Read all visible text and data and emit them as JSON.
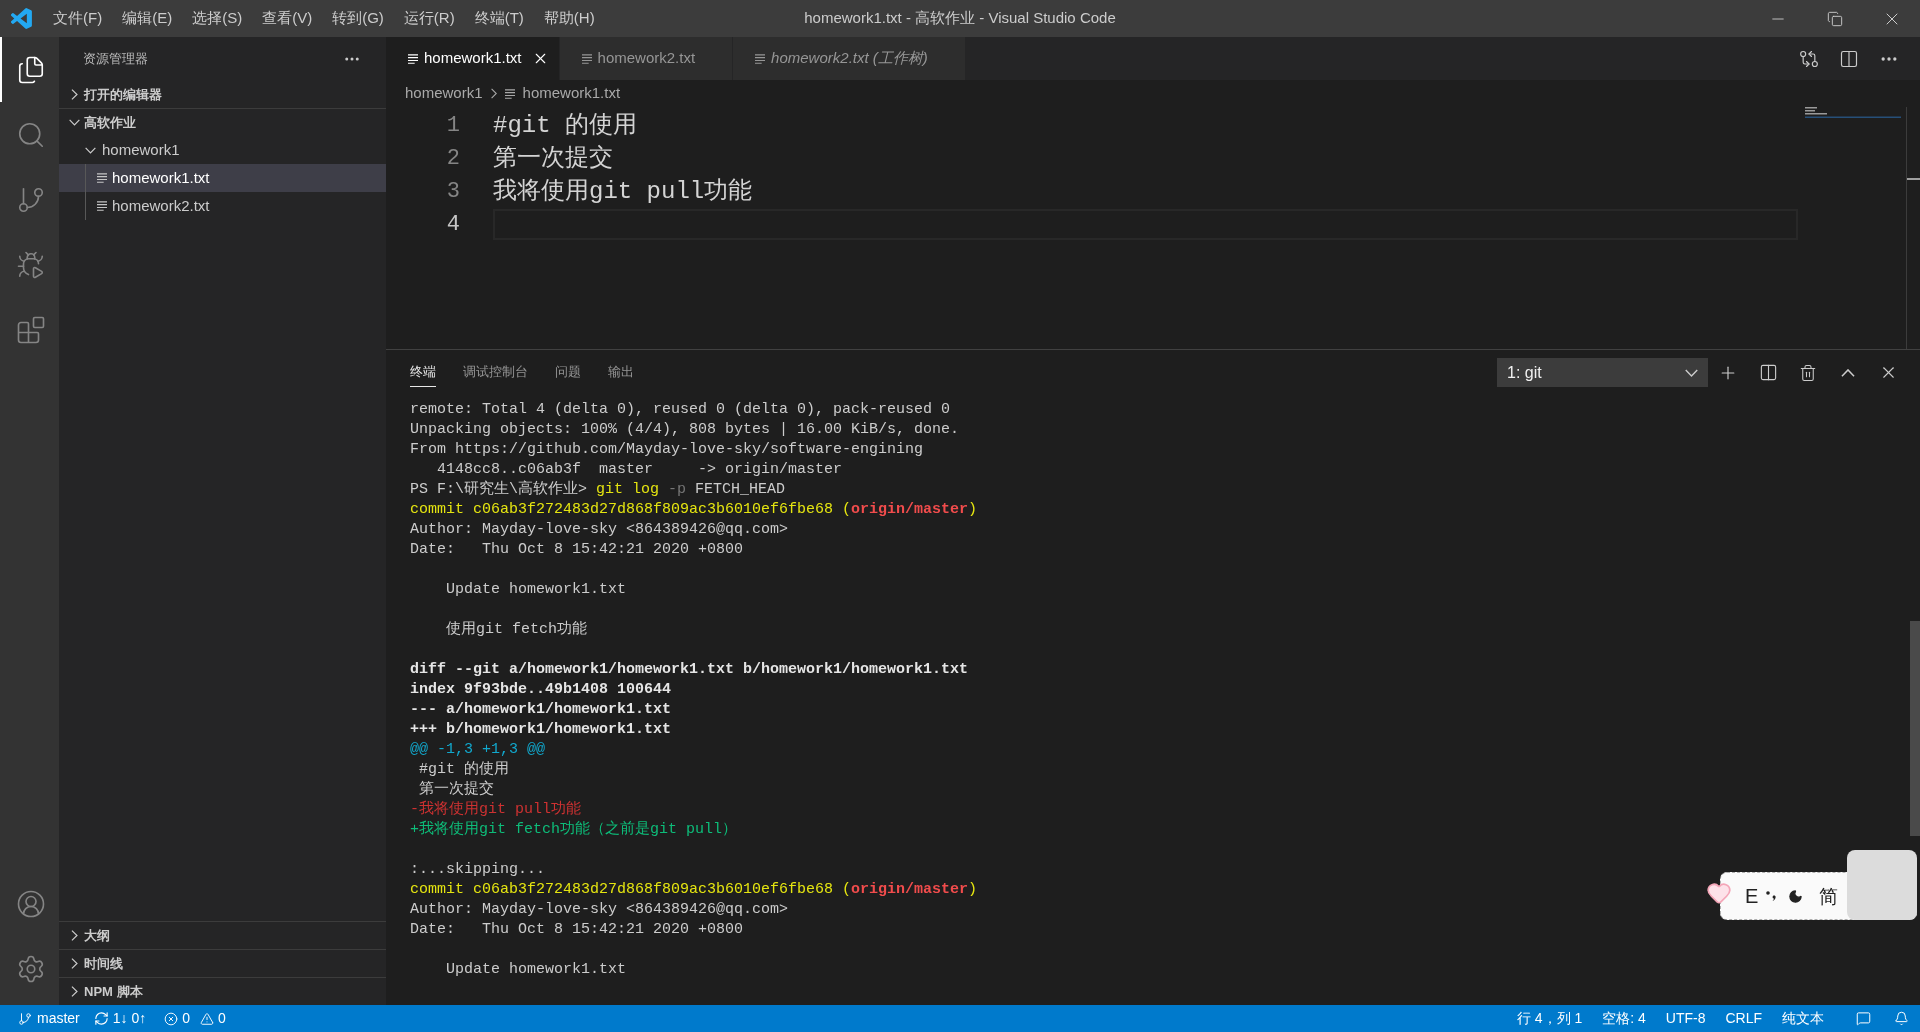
{
  "title_bar": {
    "menu": [
      "文件(F)",
      "编辑(E)",
      "选择(S)",
      "查看(V)",
      "转到(G)",
      "运行(R)",
      "终端(T)",
      "帮助(H)"
    ],
    "title": "homework1.txt - 高软作业 - Visual Studio Code"
  },
  "activity_bar": {
    "items": [
      {
        "kind": "explorer",
        "selected": true
      },
      {
        "kind": "search",
        "selected": false
      },
      {
        "kind": "source-control",
        "selected": false
      },
      {
        "kind": "run",
        "selected": false
      },
      {
        "kind": "extensions",
        "selected": false
      }
    ],
    "bottom": [
      {
        "kind": "account"
      },
      {
        "kind": "settings"
      }
    ]
  },
  "sidebar": {
    "title": "资源管理器",
    "sections": [
      {
        "label": "打开的编辑器",
        "expanded": false
      },
      {
        "label": "高软作业",
        "expanded": true,
        "tree": [
          {
            "kind": "folder",
            "label": "homework1",
            "expanded": true,
            "selected": false,
            "children": [
              {
                "kind": "file",
                "label": "homework1.txt",
                "selected": true
              },
              {
                "kind": "file",
                "label": "homework2.txt",
                "selected": false
              }
            ]
          }
        ]
      }
    ],
    "bottom_sections": [
      {
        "label": "大纲",
        "expanded": false
      },
      {
        "label": "时间线",
        "expanded": false
      },
      {
        "label": "NPM 脚本",
        "expanded": false
      }
    ]
  },
  "editor": {
    "tabs": [
      {
        "label": "homework1.txt",
        "selected": true,
        "preview": false
      },
      {
        "label": "homework2.txt",
        "selected": false,
        "preview": false
      },
      {
        "label": "homework2.txt (工作树)",
        "selected": false,
        "preview": true
      }
    ],
    "breadcrumbs": [
      "homework1",
      "homework1.txt"
    ],
    "lines": [
      {
        "number": "1",
        "text": "#git 的使用",
        "current": false
      },
      {
        "number": "2",
        "text": "第一次提交",
        "current": false
      },
      {
        "number": "3",
        "text": "我将使用git pull功能",
        "current": false
      },
      {
        "number": "4",
        "current": true
      }
    ]
  },
  "panel": {
    "tabs": [
      {
        "label": "终端",
        "selected": true
      },
      {
        "label": "调试控制台",
        "selected": false
      },
      {
        "label": "问题",
        "selected": false
      },
      {
        "label": "输出",
        "selected": false
      }
    ],
    "terminal_select": "1: git",
    "terminal_lines": [
      {
        "kind": "text",
        "segments": [
          {
            "kind": "plain",
            "text": "remote: Total 4 (delta 0), reused 0 (delta 0), pack-reused 0"
          }
        ]
      },
      {
        "kind": "text",
        "segments": [
          {
            "kind": "plain",
            "text": "Unpacking objects: 100% (4/4), 808 bytes | 16.00 KiB/s, done."
          }
        ]
      },
      {
        "kind": "text",
        "segments": [
          {
            "kind": "plain",
            "text": "From https://github.com/Mayday-love-sky/software-engining"
          }
        ]
      },
      {
        "kind": "text",
        "segments": [
          {
            "kind": "plain",
            "text": "   4148cc8..c06ab3f  master     -> origin/master"
          }
        ]
      },
      {
        "kind": "text",
        "segments": [
          {
            "kind": "plain",
            "text": "PS F:\\研究生\\高软作业> "
          },
          {
            "kind": "yellow",
            "text": "git log"
          },
          {
            "kind": "dim",
            "text": " -p"
          },
          {
            "kind": "plain",
            "text": " FETCH_HEAD"
          }
        ]
      },
      {
        "kind": "text",
        "segments": [
          {
            "kind": "yellow",
            "text": "commit c06ab3f272483d27d868f809ac3b6010ef6fbe68 ("
          },
          {
            "kind": "red-bold",
            "text": "origin/master"
          },
          {
            "kind": "yellow",
            "text": ")"
          }
        ]
      },
      {
        "kind": "text",
        "segments": [
          {
            "kind": "plain",
            "text": "Author: Mayday-love-sky <864389426@qq.com>"
          }
        ]
      },
      {
        "kind": "text",
        "segments": [
          {
            "kind": "plain",
            "text": "Date:   Thu Oct 8 15:42:21 2020 +0800"
          }
        ]
      },
      {
        "kind": "blank"
      },
      {
        "kind": "text",
        "segments": [
          {
            "kind": "plain",
            "text": "    Update homework1.txt"
          }
        ]
      },
      {
        "kind": "blank"
      },
      {
        "kind": "text",
        "segments": [
          {
            "kind": "plain",
            "text": "    使用git fetch功能"
          }
        ]
      },
      {
        "kind": "blank"
      },
      {
        "kind": "text",
        "segments": [
          {
            "kind": "bold",
            "text": "diff --git a/homework1/homework1.txt b/homework1/homework1.txt"
          }
        ]
      },
      {
        "kind": "text",
        "segments": [
          {
            "kind": "bold",
            "text": "index 9f93bde..49b1408 100644"
          }
        ]
      },
      {
        "kind": "text",
        "segments": [
          {
            "kind": "bold",
            "text": "--- a/homework1/homework1.txt"
          }
        ]
      },
      {
        "kind": "text",
        "segments": [
          {
            "kind": "bold",
            "text": "+++ b/homework1/homework1.txt"
          }
        ]
      },
      {
        "kind": "text",
        "segments": [
          {
            "kind": "cyan",
            "text": "@@ -1,3 +1,3 @@"
          }
        ]
      },
      {
        "kind": "text",
        "segments": [
          {
            "kind": "plain",
            "text": " #git 的使用"
          }
        ]
      },
      {
        "kind": "text",
        "segments": [
          {
            "kind": "plain",
            "text": " 第一次提交"
          }
        ]
      },
      {
        "kind": "text",
        "segments": [
          {
            "kind": "red",
            "text": "-我将使用git pull功能"
          }
        ]
      },
      {
        "kind": "text",
        "segments": [
          {
            "kind": "green",
            "text": "+我将使用git fetch功能（之前是git pull）"
          }
        ]
      },
      {
        "kind": "blank"
      },
      {
        "kind": "text",
        "segments": [
          {
            "kind": "plain",
            "text": ":...skipping..."
          }
        ]
      },
      {
        "kind": "text",
        "segments": [
          {
            "kind": "yellow",
            "text": "commit c06ab3f272483d27d868f809ac3b6010ef6fbe68 ("
          },
          {
            "kind": "red-bold",
            "text": "origin/master"
          },
          {
            "kind": "yellow",
            "text": ")"
          }
        ]
      },
      {
        "kind": "text",
        "segments": [
          {
            "kind": "plain",
            "text": "Author: Mayday-love-sky <864389426@qq.com>"
          }
        ]
      },
      {
        "kind": "text",
        "segments": [
          {
            "kind": "plain",
            "text": "Date:   Thu Oct 8 15:42:21 2020 +0800"
          }
        ]
      },
      {
        "kind": "blank"
      },
      {
        "kind": "text",
        "segments": [
          {
            "kind": "plain",
            "text": "    Update homework1.txt"
          }
        ]
      }
    ]
  },
  "ime_toolbar": {
    "mode": "E",
    "script": "简"
  },
  "status_bar": {
    "branch": "master",
    "sync": "1↓ 0↑",
    "errors": "0",
    "warnings": "0",
    "items": [
      "行 4，列 1",
      "空格: 4",
      "UTF-8",
      "CRLF",
      "纯文本"
    ]
  }
}
